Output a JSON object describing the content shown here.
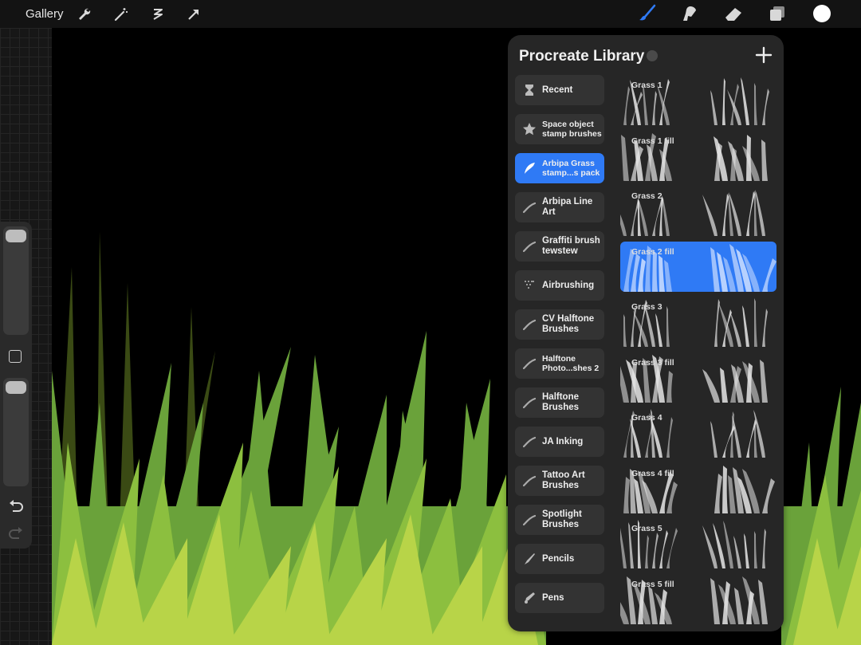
{
  "topbar": {
    "gallery_label": "Gallery",
    "left_tools": [
      "wrench-icon",
      "magic-wand-icon",
      "selection-icon",
      "transform-arrow-icon"
    ],
    "right_tools": [
      "brush-icon",
      "smudge-icon",
      "eraser-icon",
      "layers-icon",
      "color-icon"
    ],
    "active_tool": "brush-icon",
    "accent": "#2f7af5",
    "active_color": "#ffffff"
  },
  "panel": {
    "title": "Procreate Library",
    "add_icon": "plus-icon",
    "categories": [
      {
        "label": "Recent",
        "icon": "hourglass-icon"
      },
      {
        "label": "Space object stamp brushes",
        "icon": "star-icon",
        "small": true
      },
      {
        "label": "Arbipa Grass stamp...s pack",
        "icon": "feather-icon",
        "selected": true,
        "small": true
      },
      {
        "label": "Arbipa Line Art",
        "icon": "stroke-icon"
      },
      {
        "label": "Graffiti brush tewstew",
        "icon": "stroke-icon"
      },
      {
        "label": "Airbrushing",
        "icon": "airbrush-icon"
      },
      {
        "label": "CV Halftone Brushes",
        "icon": "stroke-icon"
      },
      {
        "label": "Halftone Photo...shes 2",
        "icon": "stroke-icon",
        "small": true
      },
      {
        "label": "Halftone Brushes",
        "icon": "stroke-icon"
      },
      {
        "label": "JA Inking",
        "icon": "stroke-icon"
      },
      {
        "label": "Tattoo Art Brushes",
        "icon": "stroke-icon"
      },
      {
        "label": "Spotlight Brushes",
        "icon": "stroke-icon"
      },
      {
        "label": "Pencils",
        "icon": "pencil-icon"
      },
      {
        "label": "Pens",
        "icon": "pen-icon"
      }
    ],
    "brushes": [
      {
        "label": "Grass 1"
      },
      {
        "label": "Grass 1 fill"
      },
      {
        "label": "Grass 2"
      },
      {
        "label": "Grass 2 fill",
        "selected": true
      },
      {
        "label": "Grass 3"
      },
      {
        "label": "Grass 3 fill"
      },
      {
        "label": "Grass 4"
      },
      {
        "label": "Grass 4 fill"
      },
      {
        "label": "Grass 5"
      },
      {
        "label": "Grass 5 fill"
      }
    ]
  },
  "sidebar": {
    "tools": [
      "brush-size-slider",
      "modify-square-icon",
      "opacity-slider",
      "undo-icon",
      "redo-icon"
    ]
  },
  "canvas": {
    "grass_colors": [
      "#6aa23a",
      "#8cbf3f",
      "#b8d448",
      "#3a4a14"
    ]
  }
}
